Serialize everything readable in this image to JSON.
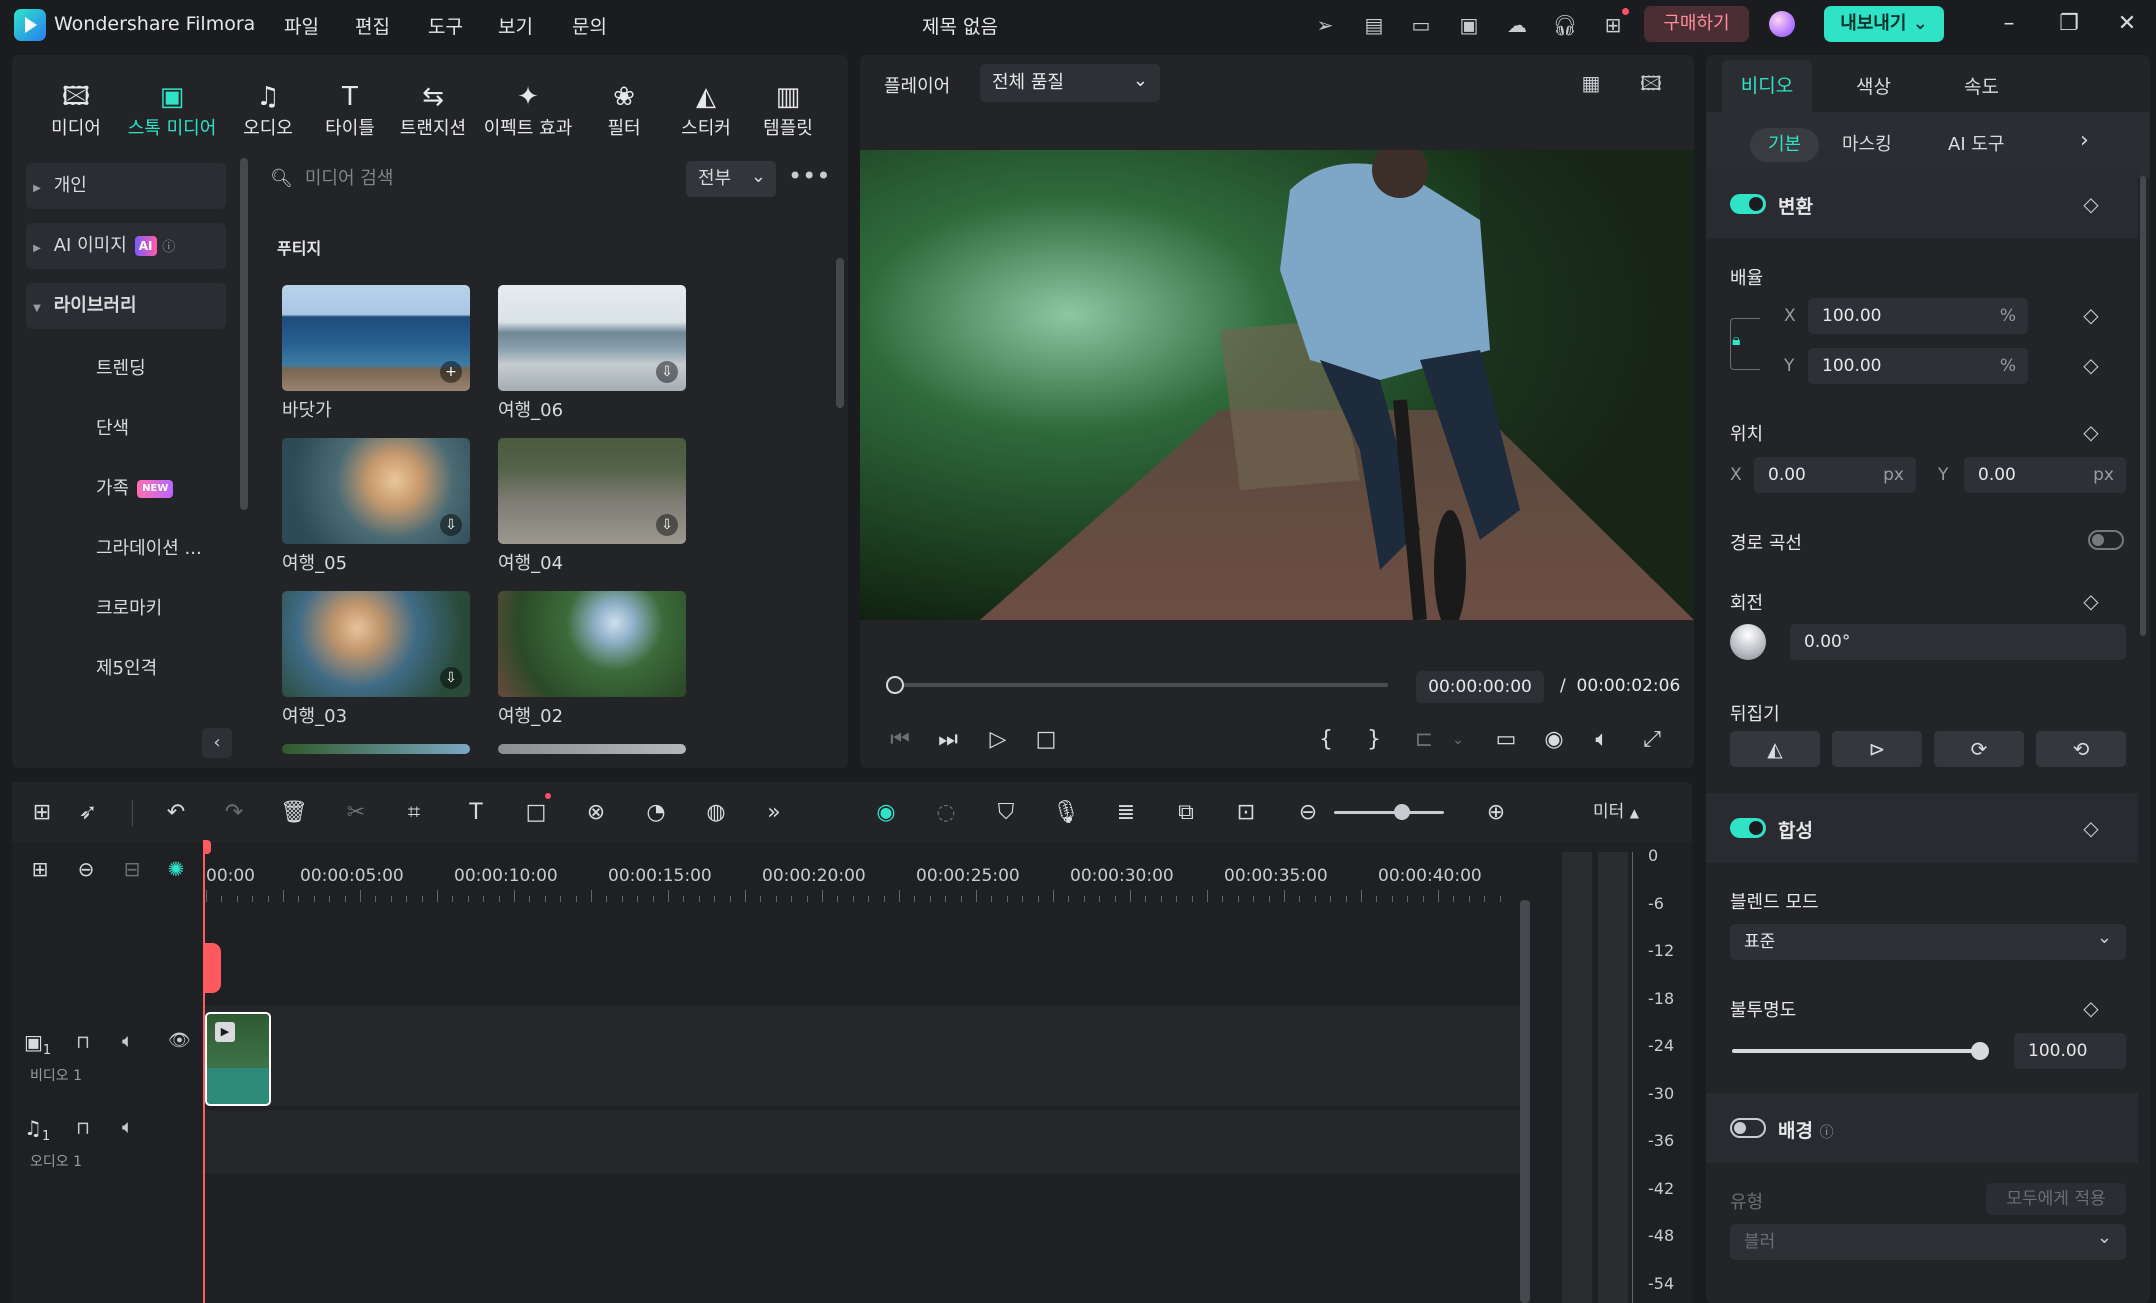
{
  "app": {
    "name": "Wondershare Filmora",
    "window_title": "제목 없음",
    "buy_label": "구매하기",
    "export_label": "내보내기"
  },
  "menu": [
    "파일",
    "편집",
    "도구",
    "보기",
    "문의"
  ],
  "media_tabs": [
    {
      "label": "미디어",
      "icon": "media-icon"
    },
    {
      "label": "스톡 미디어",
      "icon": "stock-media-icon"
    },
    {
      "label": "오디오",
      "icon": "audio-icon"
    },
    {
      "label": "타이틀",
      "icon": "title-icon"
    },
    {
      "label": "트랜지션",
      "icon": "transition-icon"
    },
    {
      "label": "이펙트 효과",
      "icon": "effects-icon"
    },
    {
      "label": "필터",
      "icon": "filter-icon"
    },
    {
      "label": "스티커",
      "icon": "sticker-icon"
    },
    {
      "label": "템플릿",
      "icon": "template-icon"
    }
  ],
  "sidebar": {
    "personal": "개인",
    "ai_image": "AI 이미지",
    "ai_badge": "AI",
    "library": "라이브러리",
    "items": [
      "트렌딩",
      "단색",
      "가족",
      "그라데이션 ...",
      "크로마키",
      "제5인격"
    ],
    "new_badge": "NEW"
  },
  "search": {
    "placeholder": "미디어 검색",
    "filter": "전부"
  },
  "footage": {
    "section": "푸티지",
    "items": [
      "바닷가",
      "여행_06",
      "여행_05",
      "여행_04",
      "여행_03",
      "여행_02"
    ]
  },
  "player": {
    "label": "플레이어",
    "quality": "전체 품질",
    "current_time": "00:00:00:00",
    "separator": "/",
    "total_time": "00:00:02:06",
    "progress": 0.0
  },
  "props": {
    "tabs": [
      "비디오",
      "색상",
      "속도"
    ],
    "subtabs": [
      "기본",
      "마스킹",
      "AI 도구"
    ],
    "transform": {
      "title": "변환",
      "scale_label": "배율",
      "scale_x": "100.00",
      "scale_y": "100.00",
      "percent": "%",
      "position_label": "위치",
      "pos_x": "0.00",
      "pos_y": "0.00",
      "px": "px",
      "x": "X",
      "y": "Y",
      "path_curve": "경로 곡선",
      "rotation_label": "회전",
      "rotation": "0.00°",
      "flip_label": "뒤집기"
    },
    "compositing": {
      "title": "합성",
      "blend_label": "블렌드 모드",
      "blend_value": "표준",
      "opacity_label": "불투명도",
      "opacity_value": "100.00",
      "opacity": 1.0
    },
    "background": {
      "title": "배경",
      "type_label": "유형",
      "apply_all": "모두에게 적용",
      "type_value": "블러"
    }
  },
  "timeline": {
    "meter_label": "미터",
    "ruler": [
      "00:00",
      "00:00:05:00",
      "00:00:10:00",
      "00:00:15:00",
      "00:00:20:00",
      "00:00:25:00",
      "00:00:30:00",
      "00:00:35:00",
      "00:00:40:00"
    ],
    "video_track": {
      "label": "비디오 1",
      "index": "1"
    },
    "audio_track": {
      "label": "오디오 1",
      "index": "1"
    },
    "meter_scale": [
      "0",
      "-6",
      "-12",
      "-18",
      "-24",
      "-30",
      "-36",
      "-42",
      "-48",
      "-54"
    ]
  },
  "colors": {
    "accent": "#2fe3c6",
    "playhead": "#ff5a5f",
    "panel": "#232428",
    "background": "#1b1c20"
  }
}
